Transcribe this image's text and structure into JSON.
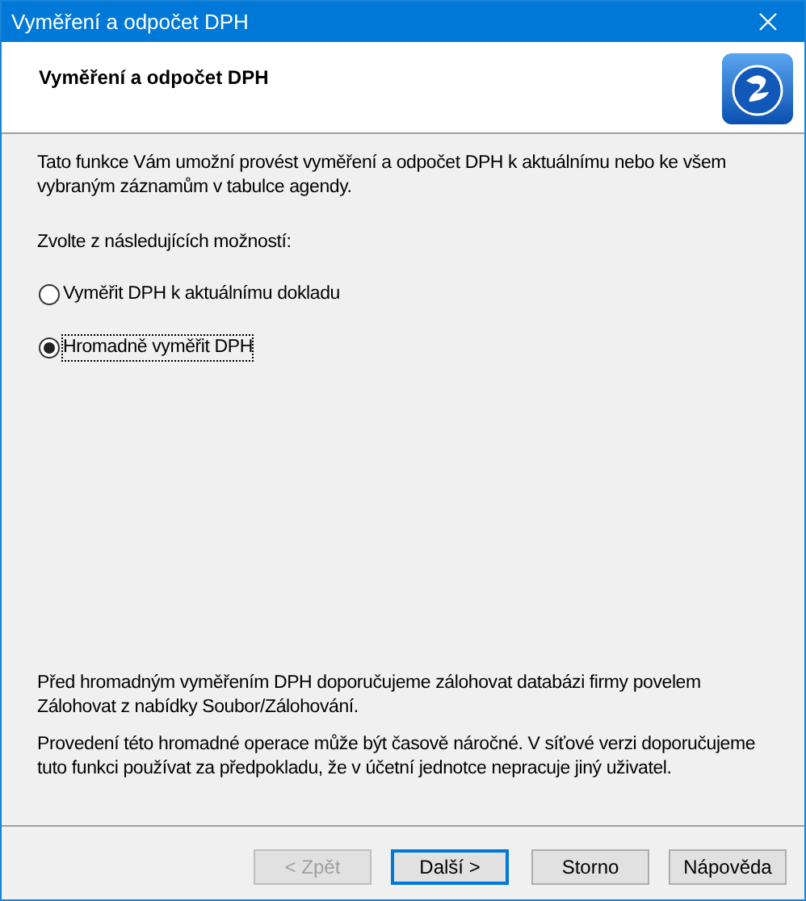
{
  "window": {
    "title": "Vyměření a odpočet DPH"
  },
  "header": {
    "title": "Vyměření a odpočet DPH"
  },
  "intro": "Tato funkce Vám umožní provést vyměření a odpočet DPH k aktuálnímu nebo ke všem vybraným záznamům v tabulce agendy.",
  "prompt": "Zvolte z následujících možností:",
  "options": [
    {
      "label": "Vyměřit DPH k aktuálnímu dokladu",
      "selected": false
    },
    {
      "label": "Hromadně vyměřit DPH",
      "selected": true
    }
  ],
  "notes": [
    "Před hromadným vyměřením DPH doporučujeme zálohovat databázi firmy povelem Zálohovat z nabídky Soubor/Zálohování.",
    "Provedení této hromadné operace může být časově náročné. V síťové verzi doporučujeme tuto funkci používat za předpokladu, že v účetní jednotce nepracuje jiný uživatel."
  ],
  "buttons": [
    {
      "label": "< Zpět",
      "disabled": true,
      "default": false
    },
    {
      "label": "Další >",
      "disabled": false,
      "default": true
    },
    {
      "label": "Storno",
      "disabled": false,
      "default": false
    },
    {
      "label": "Nápověda",
      "disabled": false,
      "default": false
    }
  ]
}
